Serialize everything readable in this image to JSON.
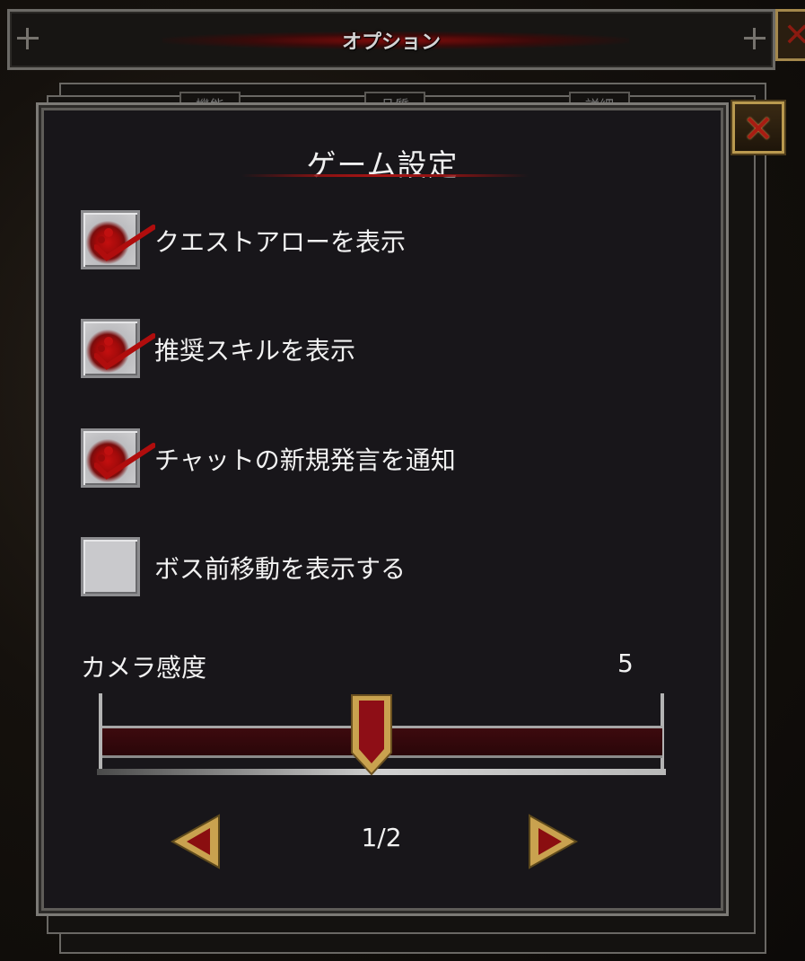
{
  "window": {
    "title": "オプション"
  },
  "background_tabs": [
    "機能",
    "品質",
    "詳細"
  ],
  "panel": {
    "title": "ゲーム設定"
  },
  "options": [
    {
      "label": "クエストアローを表示",
      "checked": true
    },
    {
      "label": "推奨スキルを表示",
      "checked": true
    },
    {
      "label": "チャットの新規発言を通知",
      "checked": true
    },
    {
      "label": "ボス前移動を表示する",
      "checked": false
    }
  ],
  "camera_sensitivity": {
    "label": "カメラ感度",
    "value": "5",
    "min": 1,
    "max": 10,
    "level": 5
  },
  "pagination": {
    "text": "1/2",
    "current": 1,
    "total": 2
  },
  "icons": {
    "close": "close-icon",
    "prev": "arrow-left-icon",
    "next": "arrow-right-icon",
    "check": "blood-checkmark-icon"
  },
  "colors": {
    "accent_red": "#a81616",
    "gold": "#b9994f",
    "panel_bg": "#18161a"
  }
}
